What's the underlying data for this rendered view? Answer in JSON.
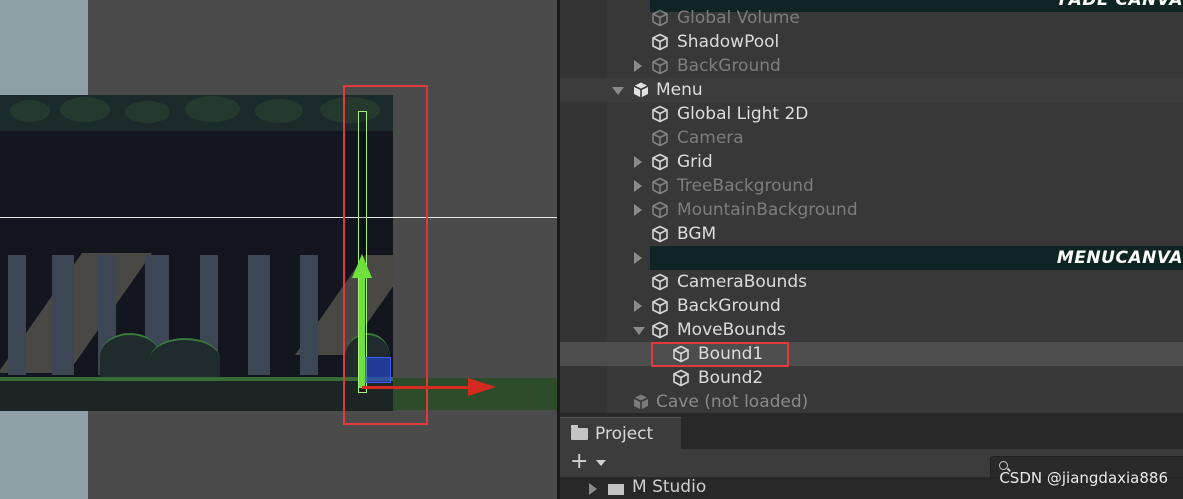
{
  "hierarchy": {
    "rows": [
      {
        "key": "fade_canvas",
        "label": "FADE CANVA",
        "kind": "canvas",
        "dim": false
      },
      {
        "key": "global_volume",
        "label": "Global Volume",
        "kind": "object",
        "dim": true
      },
      {
        "key": "shadow_pool",
        "label": "ShadowPool",
        "kind": "object",
        "dim": false
      },
      {
        "key": "background_top",
        "label": "BackGround",
        "kind": "object",
        "dim": true
      },
      {
        "key": "menu",
        "label": "Menu",
        "kind": "scene"
      },
      {
        "key": "global_light",
        "label": "Global Light 2D",
        "kind": "object",
        "dim": false
      },
      {
        "key": "camera",
        "label": "Camera",
        "kind": "object",
        "dim": true
      },
      {
        "key": "grid",
        "label": "Grid",
        "kind": "object",
        "dim": false
      },
      {
        "key": "tree_background",
        "label": "TreeBackground",
        "kind": "object",
        "dim": true
      },
      {
        "key": "mountain_background",
        "label": "MountainBackground",
        "kind": "object",
        "dim": true
      },
      {
        "key": "bgm",
        "label": "BGM",
        "kind": "object",
        "dim": false
      },
      {
        "key": "menu_canvas",
        "label": "MENUCANVA",
        "kind": "canvas"
      },
      {
        "key": "camera_bounds",
        "label": "CameraBounds",
        "kind": "object",
        "dim": false
      },
      {
        "key": "background",
        "label": "BackGround",
        "kind": "object",
        "dim": false
      },
      {
        "key": "move_bounds",
        "label": "MoveBounds",
        "kind": "object",
        "dim": false
      },
      {
        "key": "bound1",
        "label": "Bound1",
        "kind": "object",
        "dim": false
      },
      {
        "key": "bound2",
        "label": "Bound2",
        "kind": "object",
        "dim": false
      },
      {
        "key": "cave",
        "label": "Cave (not loaded)",
        "kind": "scene-unloaded"
      }
    ]
  },
  "project": {
    "tab_label": "Project",
    "add_label": "+",
    "item_label": "M Studio"
  },
  "watermark": "CSDN @jiangdaxia886",
  "icons": {
    "gameobject": "cube-icon",
    "scene": "unity-scene-icon",
    "folder": "folder-icon",
    "search": "search-icon"
  },
  "colors": {
    "selection_outline": "#e03a3a",
    "gizmo_y": "#6fe03c",
    "gizmo_x": "#d6291f",
    "canvas_bar": "#0f2424"
  }
}
